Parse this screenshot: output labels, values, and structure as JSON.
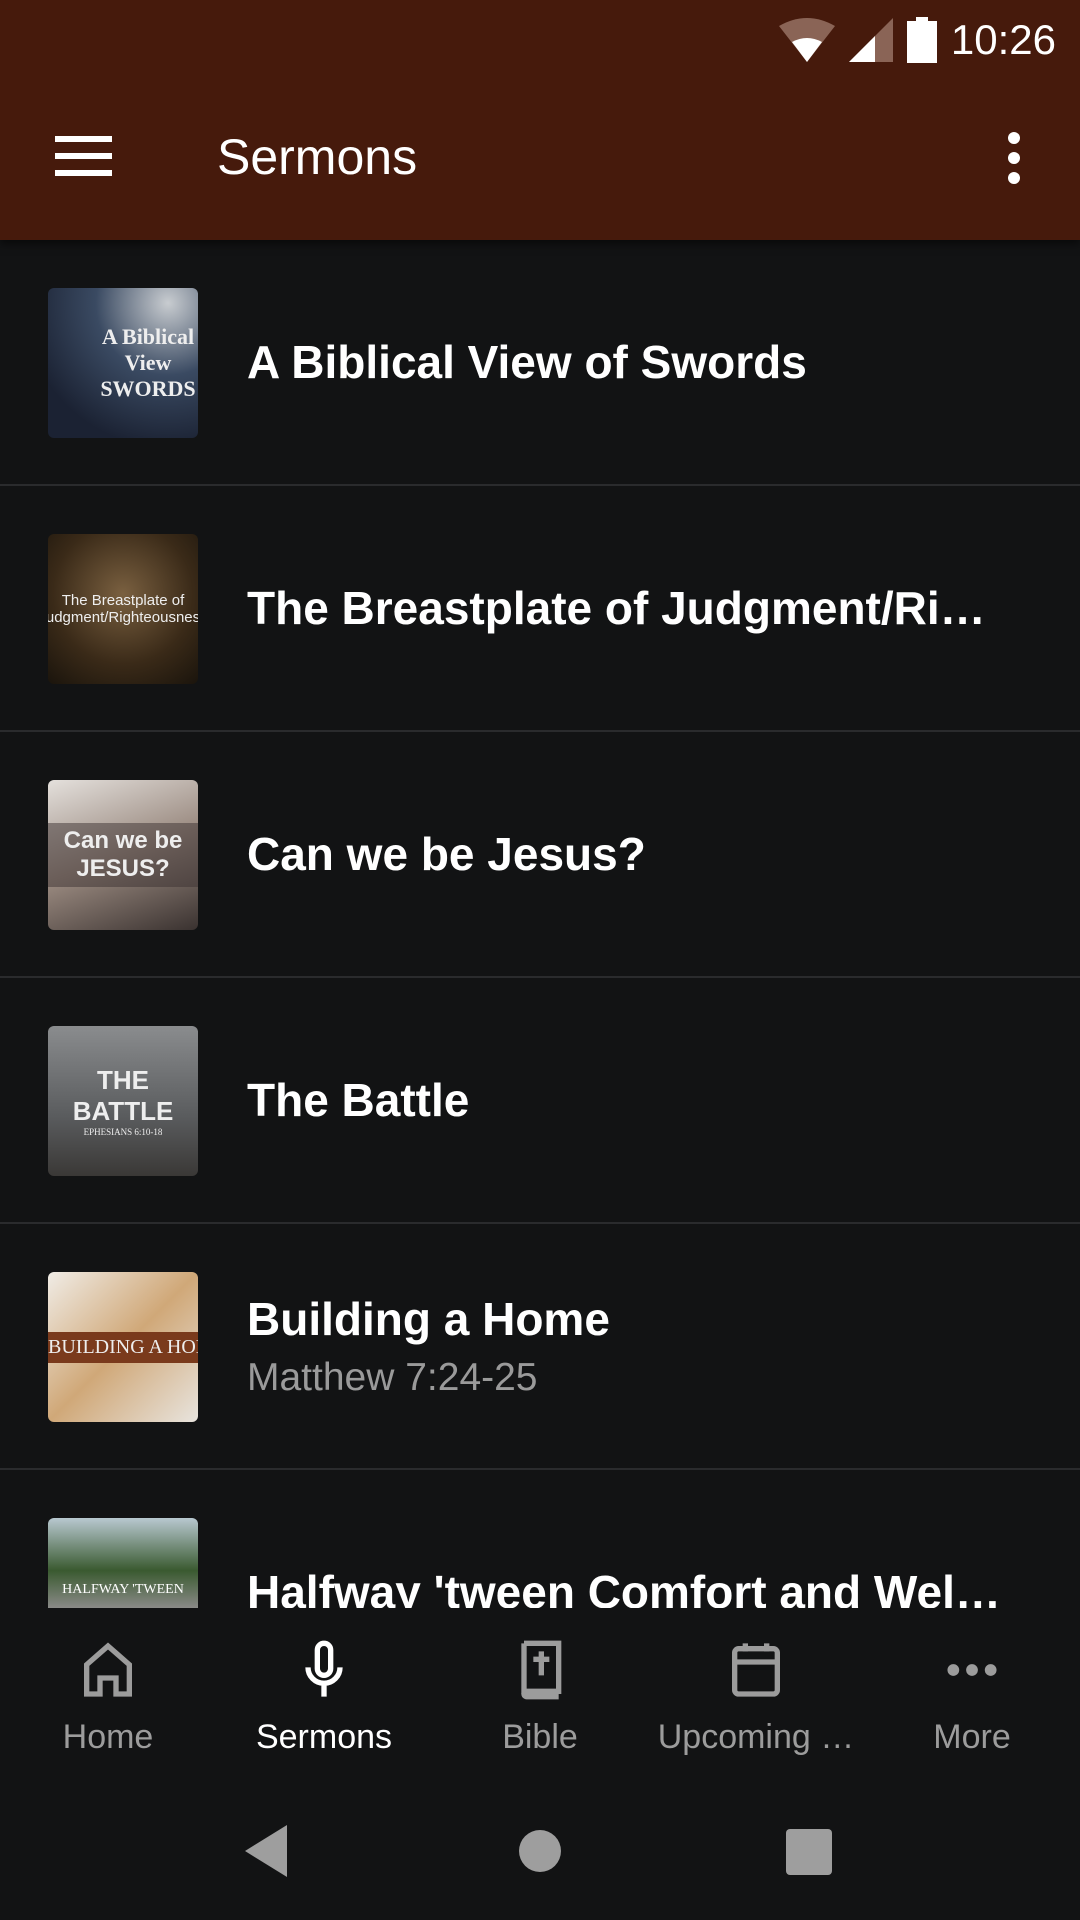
{
  "status_bar": {
    "time": "10:26",
    "icons": [
      "wifi-icon",
      "signal-icon",
      "battery-icon"
    ]
  },
  "toolbar": {
    "title": "Sermons",
    "menu_icon": "hamburger-icon",
    "overflow_icon": "more-vert-icon"
  },
  "colors": {
    "appbar": "#461a0c",
    "background": "#121314",
    "inactive": "#9c9c9c"
  },
  "sermons": [
    {
      "title": "A Biblical View of Swords",
      "thumb_text": "A Biblical View SWORDS"
    },
    {
      "title": "The Breastplate of Judgment/Ri…",
      "thumb_text": "The Breastplate of Judgment/Righteousness"
    },
    {
      "title": "Can we be Jesus?",
      "thumb_text": "Can we be JESUS?"
    },
    {
      "title": "The Battle",
      "thumb_text": "THE BATTLE",
      "thumb_sub": "EPHESIANS 6:10-18"
    },
    {
      "title": "Building a Home",
      "subtitle": "Matthew 7:24-25",
      "thumb_text": "BUILDING A HOME"
    },
    {
      "title": "Halfway 'tween Comfort and Wel…",
      "thumb_text": "HALFWAY 'TWEEN"
    }
  ],
  "bottom_nav": [
    {
      "label": "Home",
      "icon": "home-icon"
    },
    {
      "label": "Sermons",
      "icon": "microphone-icon",
      "active": true
    },
    {
      "label": "Bible",
      "icon": "bible-icon"
    },
    {
      "label": "Upcoming …",
      "icon": "calendar-icon"
    },
    {
      "label": "More",
      "icon": "more-horiz-icon"
    }
  ]
}
